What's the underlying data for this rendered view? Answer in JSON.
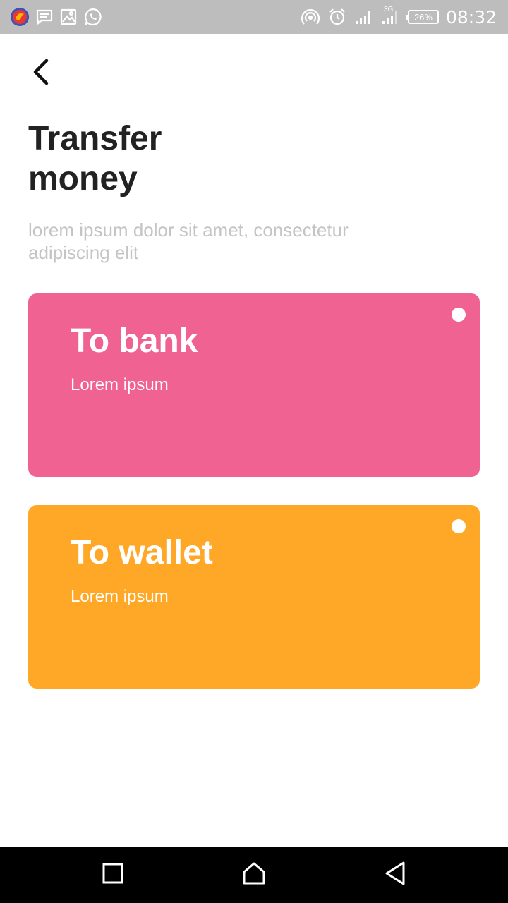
{
  "status_bar": {
    "time": "08:32",
    "battery": "26%",
    "left_icons": [
      "browser-app-icon",
      "message-icon",
      "gallery-icon",
      "whatsapp-icon"
    ],
    "right_icons": [
      "hotspot-icon",
      "alarm-icon",
      "signal-icon",
      "signal-3g-icon",
      "battery-icon"
    ],
    "network_label": "3G"
  },
  "header": {
    "back_icon": "chevron-left-icon",
    "title_line1": "Transfer",
    "title_line2": "money",
    "subtitle": "lorem ipsum dolor sit amet, consectetur adipiscing elit"
  },
  "options": [
    {
      "title": "To bank",
      "subtitle": "Lorem ipsum",
      "color": "#f06292"
    },
    {
      "title": "To wallet",
      "subtitle": "Lorem ipsum",
      "color": "#ffa726"
    }
  ],
  "nav_bar": {
    "icons": [
      "recent-apps-icon",
      "home-icon",
      "back-icon"
    ]
  }
}
